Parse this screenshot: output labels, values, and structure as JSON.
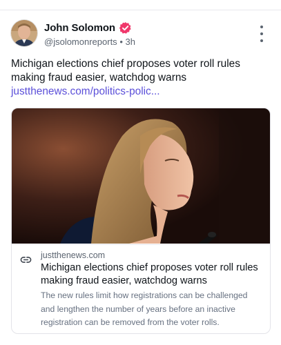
{
  "post": {
    "author_name": "John Solomon",
    "handle": "@jsolomonreports",
    "separator": "•",
    "time": "3h",
    "text": "Michigan elections chief proposes voter roll rules making fraud easier, watchdog warns",
    "link_text": "justthenews.com/politics-polic..."
  },
  "card": {
    "domain": "justthenews.com",
    "title": "Michigan elections chief proposes voter roll rules making fraud easier, watchdog warns",
    "description": "The new rules limit how registrations can be challenged and lengthen the number of years before an inactive registration can be removed from the voter rolls."
  },
  "icons": {
    "verified": "verified-badge-icon",
    "menu": "more-vertical-icon",
    "link": "link-icon"
  },
  "colors": {
    "verified_badge": "#f0386b",
    "link": "#5b4fd9"
  }
}
